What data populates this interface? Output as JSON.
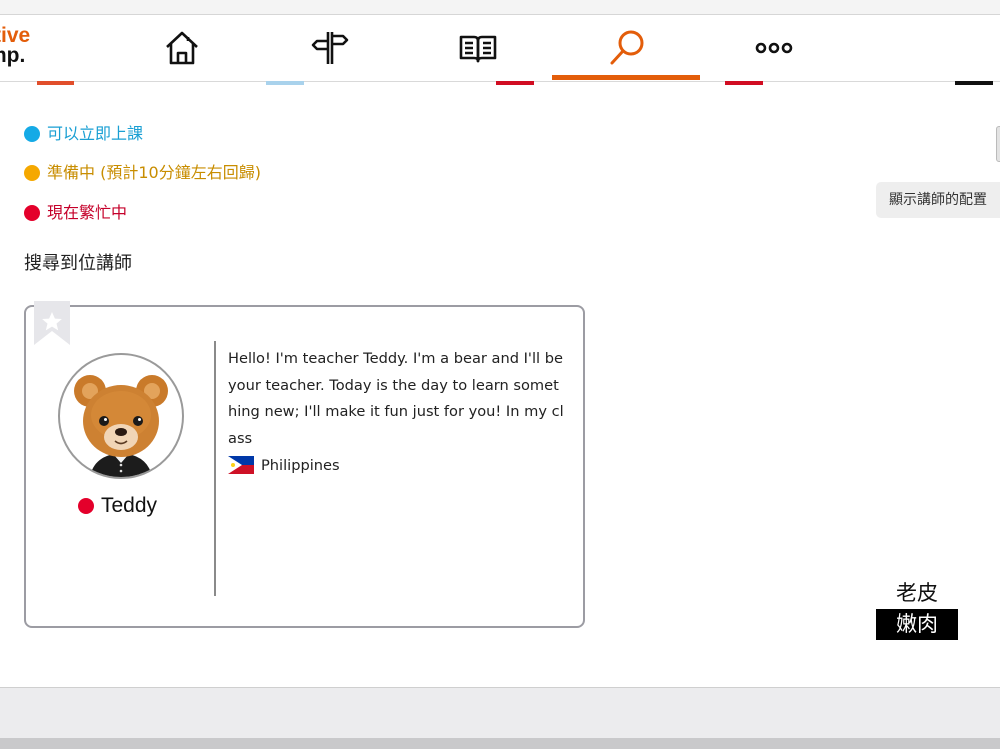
{
  "logo": {
    "line1": "tive",
    "line2": "mp."
  },
  "nav": {
    "items": [
      {
        "icon": "home-icon",
        "active": false
      },
      {
        "icon": "signpost-icon",
        "active": false
      },
      {
        "icon": "book-icon",
        "active": false
      },
      {
        "icon": "search-icon",
        "active": true
      },
      {
        "icon": "more-icon",
        "active": false
      }
    ],
    "accent_color": "#e35d0a"
  },
  "legend": [
    {
      "label": "可以立即上課",
      "color": "#15aae6",
      "text_color": "#1a9fd3"
    },
    {
      "label": "準備中 (預計10分鐘左右回歸)",
      "color": "#f5a800",
      "text_color": "#c88d00"
    },
    {
      "label": "現在繁忙中",
      "color": "#e4002b",
      "text_color": "#c5002a"
    }
  ],
  "results": {
    "heading": "搜尋到位講師"
  },
  "config_button": {
    "label": "顯示講師的配置"
  },
  "teacher": {
    "name": "Teddy",
    "status": "busy",
    "status_color": "#e4002b",
    "intro": "Hello! I'm teacher Teddy. I'm a bear and I'll be your teacher. Today is the day to learn something new; I'll make it fun just for you! In my class",
    "country": "Philippines",
    "flag": "philippines-flag-icon",
    "favorite_icon": "bookmark-star-icon"
  },
  "watermark": {
    "top": "老皮",
    "bottom": "嫩肉"
  }
}
